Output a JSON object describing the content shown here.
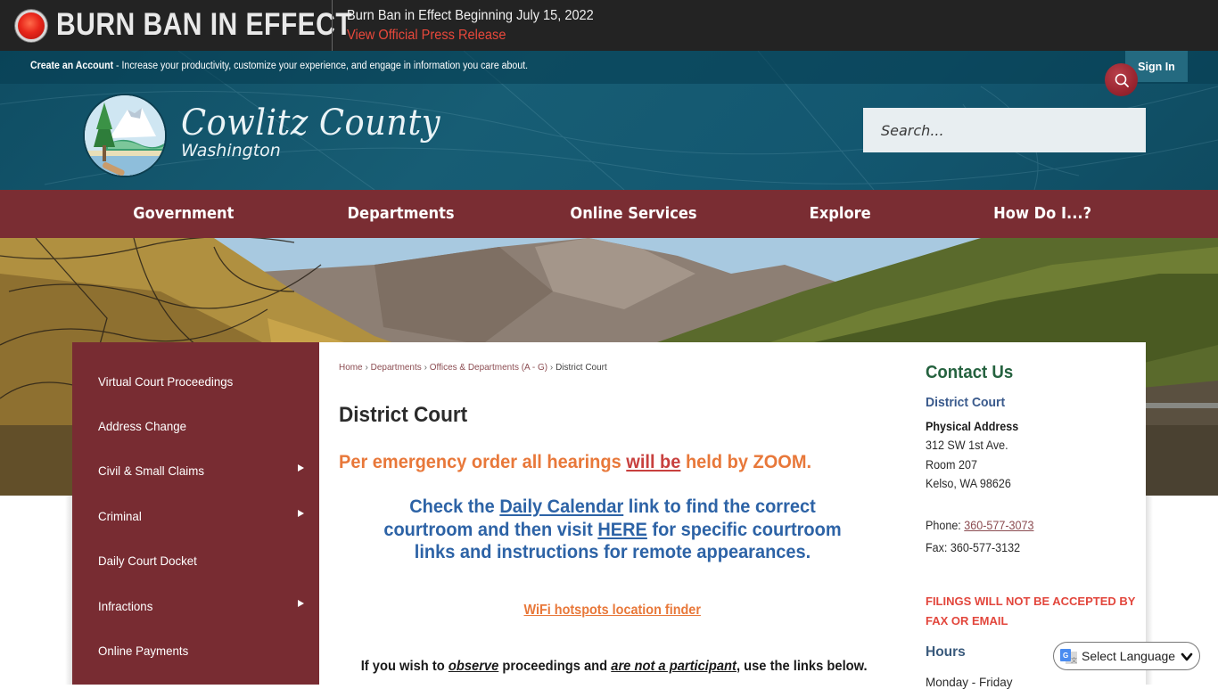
{
  "alert": {
    "title": "BURN BAN IN EFFECT",
    "message": "Burn Ban in Effect Beginning July 15, 2022",
    "link_label": "View Official Press Release",
    "icon": "red-alert-light-icon"
  },
  "account_bar": {
    "create_account_label": "Create an Account",
    "description": " - Increase your productivity, customize your experience, and engage in information you care about.",
    "sign_in_label": "Sign In"
  },
  "branding": {
    "name": "Cowlitz County",
    "state": "Washington",
    "seal_icon": "county-seal-logo"
  },
  "search": {
    "placeholder": "Search...",
    "value": "",
    "button_icon": "search-icon"
  },
  "nav": {
    "items": [
      {
        "label": "Government"
      },
      {
        "label": "Departments"
      },
      {
        "label": "Online Services"
      },
      {
        "label": "Explore"
      },
      {
        "label": "How Do I...?"
      }
    ]
  },
  "sidebar": {
    "items": [
      {
        "label": "Virtual Court Proceedings",
        "has_submenu": false
      },
      {
        "label": "Address Change",
        "has_submenu": false
      },
      {
        "label": "Civil & Small Claims",
        "has_submenu": true
      },
      {
        "label": "Criminal",
        "has_submenu": true
      },
      {
        "label": "Daily Court Docket",
        "has_submenu": false
      },
      {
        "label": "Infractions",
        "has_submenu": true
      },
      {
        "label": "Online Payments",
        "has_submenu": false
      }
    ]
  },
  "breadcrumb": {
    "items": [
      {
        "label": "Home"
      },
      {
        "label": "Departments"
      },
      {
        "label": "Offices & Departments (A - G)"
      }
    ],
    "current": "District Court"
  },
  "main": {
    "title": "District Court",
    "emergency": {
      "before": "Per emergency order all hearings ",
      "emphasis": "will be",
      "after": " held by ZOOM."
    },
    "check": {
      "line1_before": "Check the ",
      "daily_calendar_link": "Daily Calendar",
      "line1_after": " link to find the correct",
      "line2_before": "courtroom and then visit ",
      "here_link": "HERE",
      "line2_after": " for specific courtroom",
      "line3": "links and instructions for remote appearances."
    },
    "wifi_link": "WiFi hotspots location finder",
    "observe": {
      "part1": "If you wish to ",
      "em1": "observe",
      "part2": " proceedings and ",
      "em2": "are not a participant",
      "part3": ", use the links below."
    }
  },
  "contact": {
    "title": "Contact Us",
    "department": "District Court",
    "address_label": "Physical Address",
    "address_lines": [
      "312 SW 1st Ave.",
      "Room 207",
      "Kelso, WA 98626"
    ],
    "phone_label": "Phone: ",
    "phone": "360-577-3073",
    "fax": "Fax: 360-577-3132",
    "filings_notice": "FILINGS WILL NOT BE ACCEPTED BY FAX OR EMAIL",
    "hours_title": "Hours",
    "hours_line": "Monday - Friday"
  },
  "translate": {
    "label": "Select Language"
  },
  "colors": {
    "alert_bg": "#232323",
    "alert_link": "#e8483b",
    "header_teal": "#135770",
    "nav_maroon": "#7a2d33",
    "sidebar_maroon": "#782c32",
    "emergency_orange": "#e8783a",
    "notice_blue": "#2d63a6",
    "contact_green": "#25623f",
    "filings_red": "#e2463c"
  }
}
